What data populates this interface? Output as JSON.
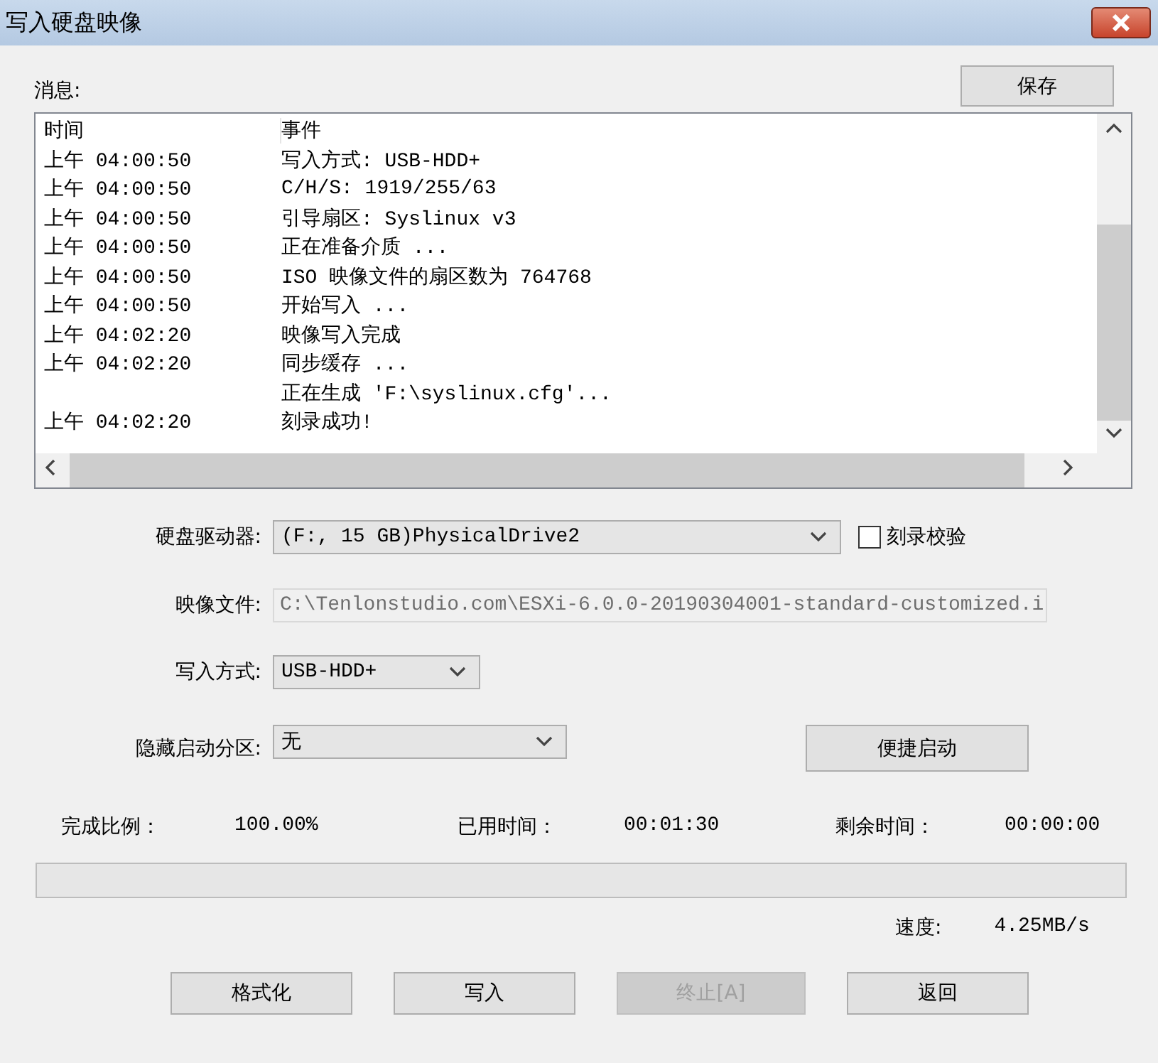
{
  "window": {
    "title": "写入硬盘映像"
  },
  "messages": {
    "label": "消息:",
    "save_button": "保存",
    "columns": [
      "时间",
      "事件"
    ],
    "rows": [
      {
        "time": "上午 04:00:50",
        "event": "写入方式: USB-HDD+"
      },
      {
        "time": "上午 04:00:50",
        "event": "C/H/S: 1919/255/63"
      },
      {
        "time": "上午 04:00:50",
        "event": "引导扇区: Syslinux v3"
      },
      {
        "time": "上午 04:00:50",
        "event": "正在准备介质 ..."
      },
      {
        "time": "上午 04:00:50",
        "event": "ISO 映像文件的扇区数为 764768"
      },
      {
        "time": "上午 04:00:50",
        "event": "开始写入 ..."
      },
      {
        "time": "上午 04:02:20",
        "event": "映像写入完成"
      },
      {
        "time": "上午 04:02:20",
        "event": "同步缓存 ..."
      },
      {
        "event": "正在生成 'F:\\syslinux.cfg'..."
      },
      {
        "time": "上午 04:02:20",
        "event": "刻录成功!"
      }
    ]
  },
  "form": {
    "drive": {
      "label": "硬盘驱动器:",
      "value": "(F:, 15 GB)PhysicalDrive2"
    },
    "verify": {
      "label": "刻录校验",
      "checked": false
    },
    "image_file": {
      "label": "映像文件:",
      "value": "C:\\Tenlonstudio.com\\ESXi-6.0.0-20190304001-standard-customized.i",
      "disabled": true
    },
    "write_mode": {
      "label": "写入方式:",
      "value": "USB-HDD+"
    },
    "hidden_partition": {
      "label": "隐藏启动分区:",
      "value": "无"
    },
    "quick_boot_button": "便捷启动"
  },
  "stats": [
    {
      "label": "完成比例：",
      "value": "100.00%"
    },
    {
      "label": "已用时间：",
      "value": "00:01:30"
    },
    {
      "label": "剩余时间：",
      "value": "00:00:00"
    }
  ],
  "progress": {
    "level": 0
  },
  "speed": {
    "label": "速度:",
    "value": "4.25MB/s"
  },
  "buttons": [
    {
      "label": "格式化",
      "disabled": false
    },
    {
      "label": "写入",
      "disabled": false
    },
    {
      "label": "终止[A]",
      "disabled": true
    },
    {
      "label": "返回",
      "disabled": false
    }
  ]
}
